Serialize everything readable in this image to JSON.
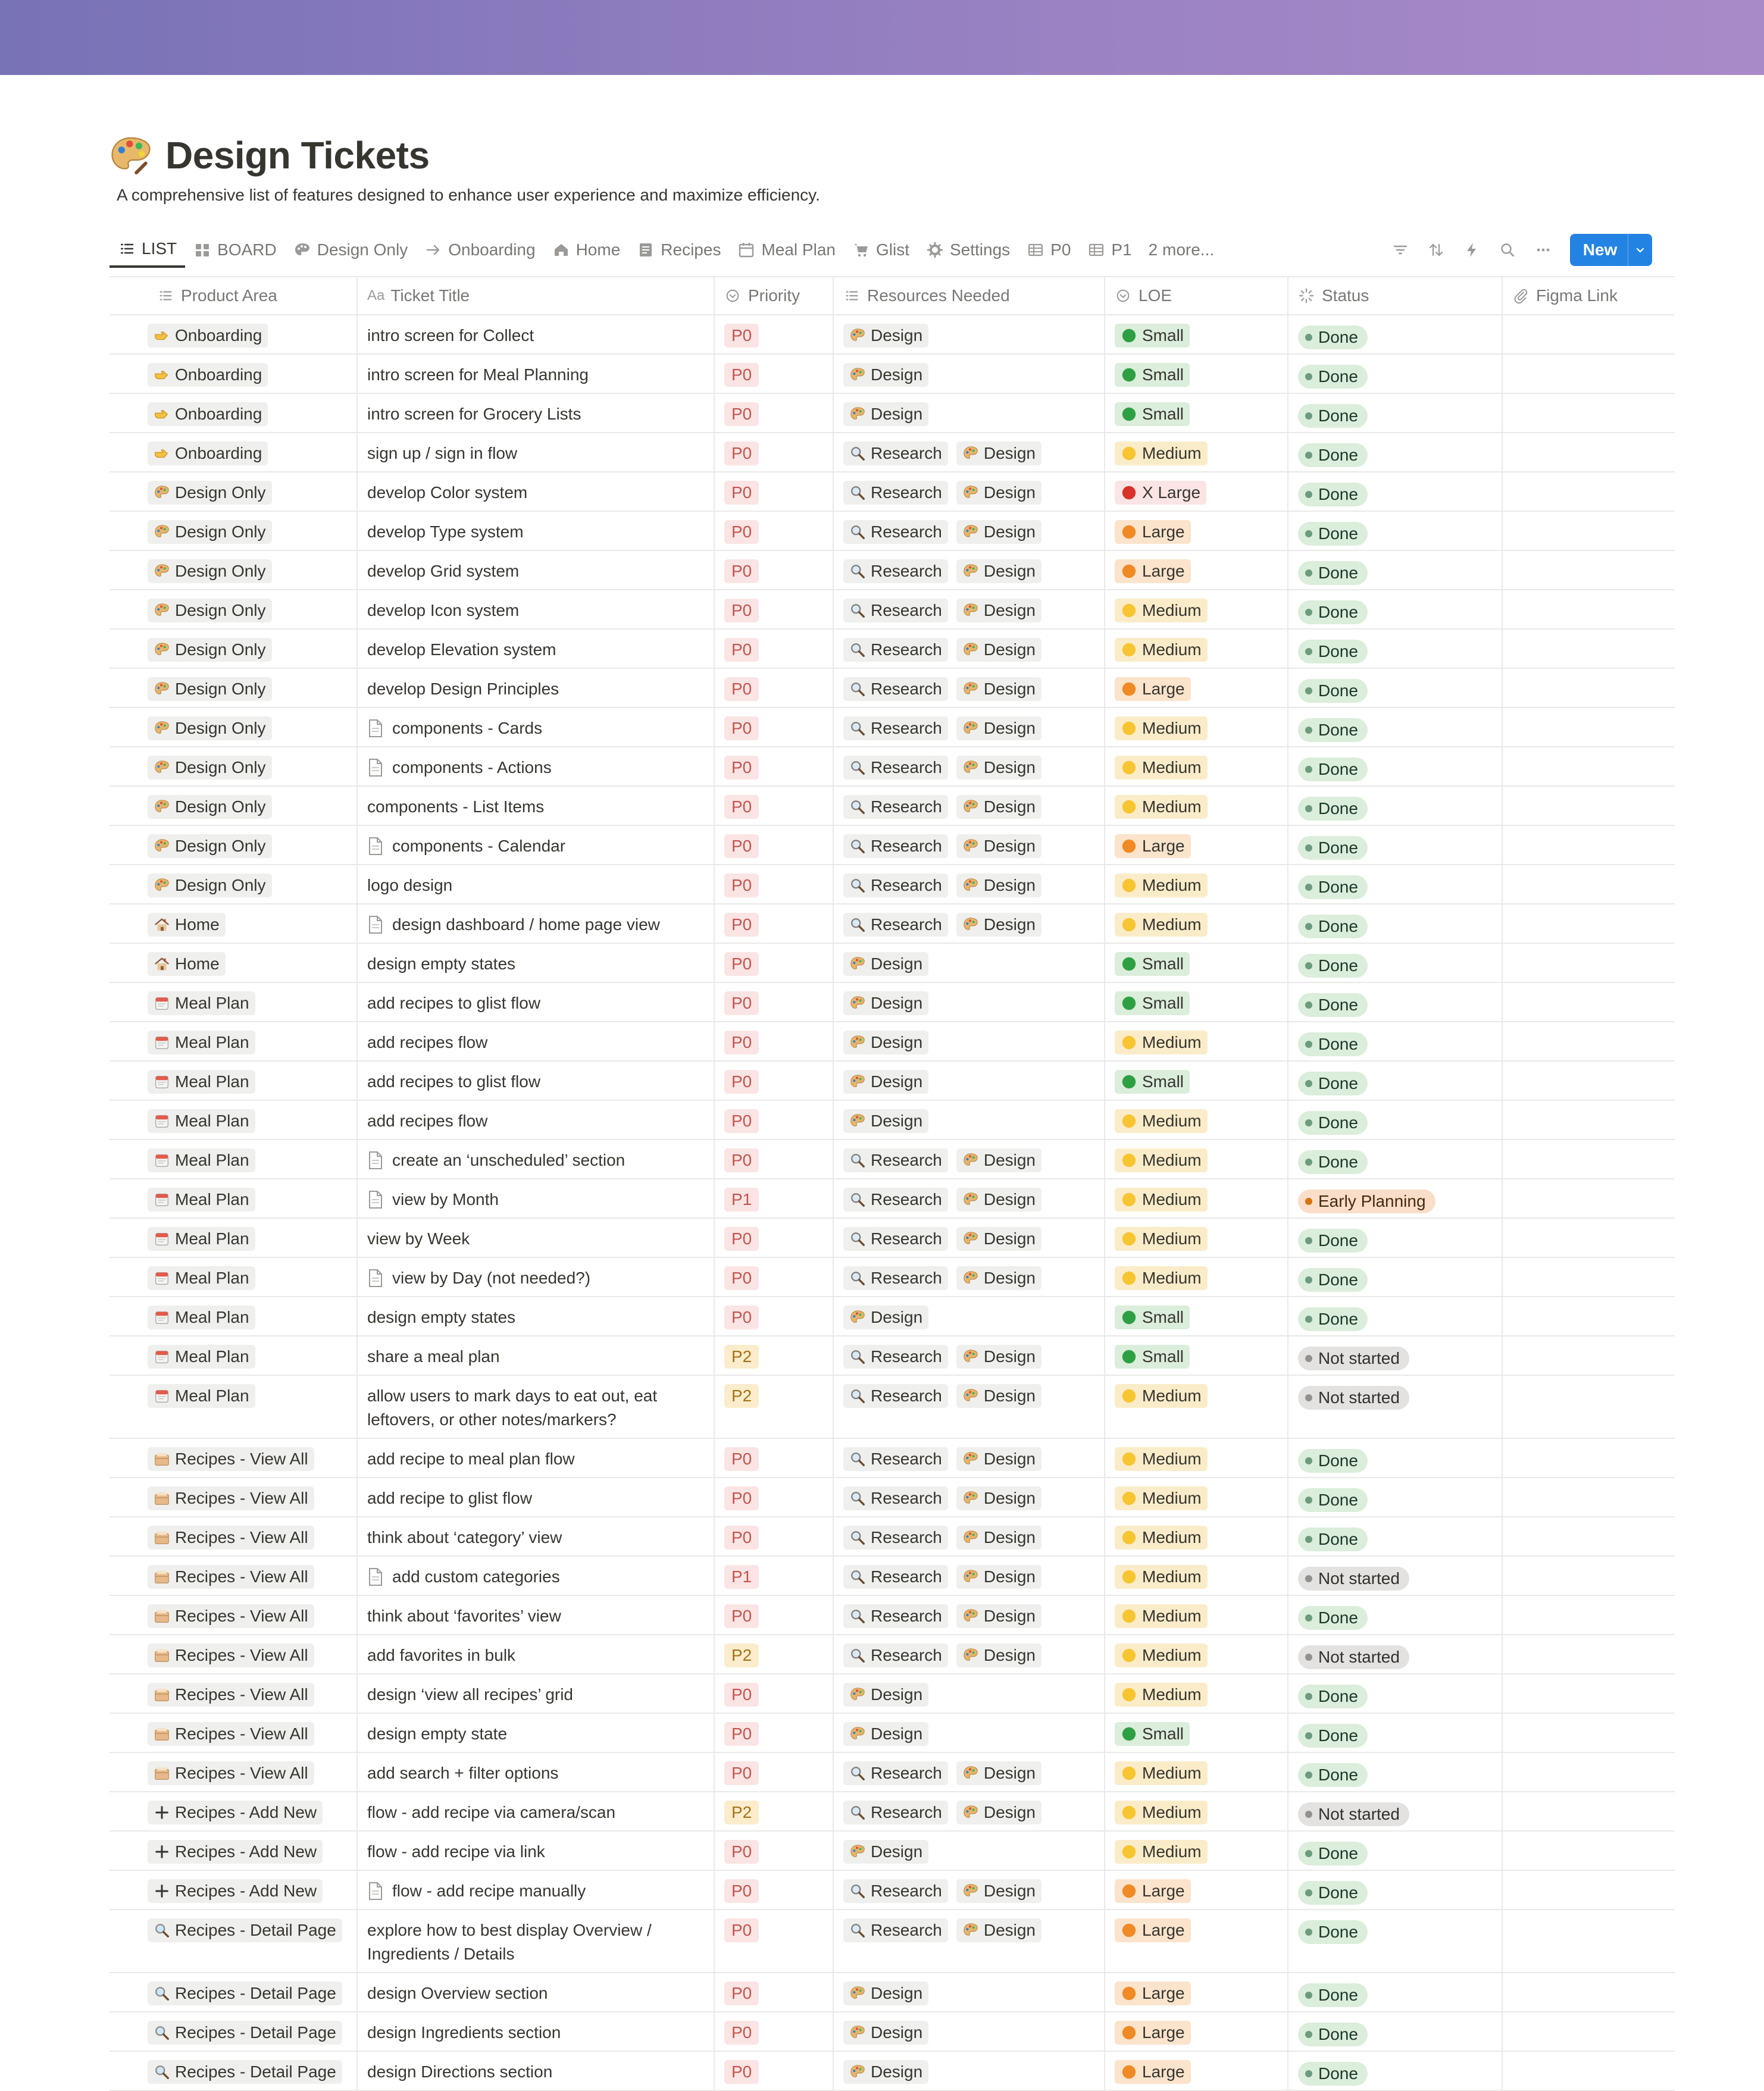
{
  "page": {
    "title": "Design Tickets",
    "title_icon": "palette-icon",
    "description": "A comprehensive list of features designed to enhance user experience and maximize efficiency.",
    "cover_colors": [
      "#7872b6",
      "#a98ac9"
    ]
  },
  "views": [
    {
      "label": "LIST",
      "icon": "list-icon",
      "active": true
    },
    {
      "label": "BOARD",
      "icon": "board-icon"
    },
    {
      "label": "Design Only",
      "icon": "palette-icon"
    },
    {
      "label": "Onboarding",
      "icon": "arrow-right-icon"
    },
    {
      "label": "Home",
      "icon": "home-icon"
    },
    {
      "label": "Recipes",
      "icon": "document-icon"
    },
    {
      "label": "Meal Plan",
      "icon": "calendar-icon"
    },
    {
      "label": "Glist",
      "icon": "cart-icon"
    },
    {
      "label": "Settings",
      "icon": "gear-icon"
    },
    {
      "label": "P0",
      "icon": "table-icon"
    },
    {
      "label": "P1",
      "icon": "table-icon"
    },
    {
      "label": "2 more...",
      "icon": ""
    }
  ],
  "toolbar": {
    "new_label": "New",
    "accent": "#2383e2"
  },
  "columns": [
    {
      "label": "Product Area",
      "icon": "list-icon"
    },
    {
      "label": "Ticket Title",
      "icon": "text-icon",
      "prefix": "Aa"
    },
    {
      "label": "Priority",
      "icon": "select-icon"
    },
    {
      "label": "Resources Needed",
      "icon": "list-icon"
    },
    {
      "label": "LOE",
      "icon": "select-icon"
    },
    {
      "label": "Status",
      "icon": "status-icon"
    },
    {
      "label": "Figma Link",
      "icon": "attachment-icon"
    }
  ],
  "rows": [
    {
      "area": "Onboarding",
      "title": "intro screen for Collect",
      "pri": "P0",
      "res": [
        "Design"
      ],
      "loe": "Small",
      "status": "Done"
    },
    {
      "area": "Onboarding",
      "title": "intro screen for Meal Planning",
      "pri": "P0",
      "res": [
        "Design"
      ],
      "loe": "Small",
      "status": "Done"
    },
    {
      "area": "Onboarding",
      "title": "intro screen for Grocery Lists",
      "pri": "P0",
      "res": [
        "Design"
      ],
      "loe": "Small",
      "status": "Done"
    },
    {
      "area": "Onboarding",
      "title": "sign up  / sign in flow",
      "pri": "P0",
      "res": [
        "Research",
        "Design"
      ],
      "loe": "Medium",
      "status": "Done"
    },
    {
      "area": "Design Only",
      "title": "develop Color system",
      "pri": "P0",
      "res": [
        "Research",
        "Design"
      ],
      "loe": "X Large",
      "status": "Done"
    },
    {
      "area": "Design Only",
      "title": "develop Type system",
      "pri": "P0",
      "res": [
        "Research",
        "Design"
      ],
      "loe": "Large",
      "status": "Done"
    },
    {
      "area": "Design Only",
      "title": "develop Grid system",
      "pri": "P0",
      "res": [
        "Research",
        "Design"
      ],
      "loe": "Large",
      "status": "Done"
    },
    {
      "area": "Design Only",
      "title": "develop Icon system",
      "pri": "P0",
      "res": [
        "Research",
        "Design"
      ],
      "loe": "Medium",
      "status": "Done"
    },
    {
      "area": "Design Only",
      "title": "develop Elevation system",
      "pri": "P0",
      "res": [
        "Research",
        "Design"
      ],
      "loe": "Medium",
      "status": "Done"
    },
    {
      "area": "Design Only",
      "title": "develop Design Principles",
      "pri": "P0",
      "res": [
        "Research",
        "Design"
      ],
      "loe": "Large",
      "status": "Done"
    },
    {
      "area": "Design Only",
      "title": "components - Cards",
      "doc": true,
      "pri": "P0",
      "res": [
        "Research",
        "Design"
      ],
      "loe": "Medium",
      "status": "Done"
    },
    {
      "area": "Design Only",
      "title": "components - Actions",
      "doc": true,
      "pri": "P0",
      "res": [
        "Research",
        "Design"
      ],
      "loe": "Medium",
      "status": "Done"
    },
    {
      "area": "Design Only",
      "title": "components - List Items",
      "pri": "P0",
      "res": [
        "Research",
        "Design"
      ],
      "loe": "Medium",
      "status": "Done"
    },
    {
      "area": "Design Only",
      "title": "components - Calendar",
      "doc": true,
      "pri": "P0",
      "res": [
        "Research",
        "Design"
      ],
      "loe": "Large",
      "status": "Done"
    },
    {
      "area": "Design Only",
      "title": "logo design",
      "pri": "P0",
      "res": [
        "Research",
        "Design"
      ],
      "loe": "Medium",
      "status": "Done"
    },
    {
      "area": "Home",
      "title": "design dashboard / home page view",
      "doc": true,
      "pri": "P0",
      "res": [
        "Research",
        "Design"
      ],
      "loe": "Medium",
      "status": "Done"
    },
    {
      "area": "Home",
      "title": "design empty states",
      "pri": "P0",
      "res": [
        "Design"
      ],
      "loe": "Small",
      "status": "Done"
    },
    {
      "area": "Meal Plan",
      "title": "add recipes to glist flow",
      "pri": "P0",
      "res": [
        "Design"
      ],
      "loe": "Small",
      "status": "Done"
    },
    {
      "area": "Meal Plan",
      "title": "add recipes flow",
      "pri": "P0",
      "res": [
        "Design"
      ],
      "loe": "Medium",
      "status": "Done"
    },
    {
      "area": "Meal Plan",
      "title": "add recipes to glist flow",
      "pri": "P0",
      "res": [
        "Design"
      ],
      "loe": "Small",
      "status": "Done"
    },
    {
      "area": "Meal Plan",
      "title": "add recipes flow",
      "pri": "P0",
      "res": [
        "Design"
      ],
      "loe": "Medium",
      "status": "Done"
    },
    {
      "area": "Meal Plan",
      "title": "create an ‘unscheduled’ section",
      "doc": true,
      "pri": "P0",
      "res": [
        "Research",
        "Design"
      ],
      "loe": "Medium",
      "status": "Done"
    },
    {
      "area": "Meal Plan",
      "title": "view by Month",
      "doc": true,
      "pri": "P1",
      "res": [
        "Research",
        "Design"
      ],
      "loe": "Medium",
      "status": "Early Planning"
    },
    {
      "area": "Meal Plan",
      "title": "view by Week",
      "pri": "P0",
      "res": [
        "Research",
        "Design"
      ],
      "loe": "Medium",
      "status": "Done"
    },
    {
      "area": "Meal Plan",
      "title": "view by Day (not needed?)",
      "doc": true,
      "pri": "P0",
      "res": [
        "Research",
        "Design"
      ],
      "loe": "Medium",
      "status": "Done"
    },
    {
      "area": "Meal Plan",
      "title": "design empty states",
      "pri": "P0",
      "res": [
        "Design"
      ],
      "loe": "Small",
      "status": "Done"
    },
    {
      "area": "Meal Plan",
      "title": "share a meal plan",
      "pri": "P2",
      "res": [
        "Research",
        "Design"
      ],
      "loe": "Small",
      "status": "Not started"
    },
    {
      "area": "Meal Plan",
      "title": "allow users to mark days to eat out, eat leftovers, or other notes/markers?",
      "tall": true,
      "pri": "P2",
      "res": [
        "Research",
        "Design"
      ],
      "loe": "Medium",
      "status": "Not started"
    },
    {
      "area": "Recipes - View All",
      "title": "add recipe to meal plan flow",
      "pri": "P0",
      "res": [
        "Research",
        "Design"
      ],
      "loe": "Medium",
      "status": "Done"
    },
    {
      "area": "Recipes - View All",
      "title": "add recipe to glist flow",
      "pri": "P0",
      "res": [
        "Research",
        "Design"
      ],
      "loe": "Medium",
      "status": "Done"
    },
    {
      "area": "Recipes - View All",
      "title": "think about ‘category’ view",
      "pri": "P0",
      "res": [
        "Research",
        "Design"
      ],
      "loe": "Medium",
      "status": "Done"
    },
    {
      "area": "Recipes - View All",
      "title": "add custom categories",
      "doc": true,
      "pri": "P1",
      "res": [
        "Research",
        "Design"
      ],
      "loe": "Medium",
      "status": "Not started"
    },
    {
      "area": "Recipes - View All",
      "title": "think about ‘favorites’ view",
      "pri": "P0",
      "res": [
        "Research",
        "Design"
      ],
      "loe": "Medium",
      "status": "Done"
    },
    {
      "area": "Recipes - View All",
      "title": "add favorites in bulk",
      "pri": "P2",
      "res": [
        "Research",
        "Design"
      ],
      "loe": "Medium",
      "status": "Not started"
    },
    {
      "area": "Recipes - View All",
      "title": "design ‘view all recipes’ grid",
      "pri": "P0",
      "res": [
        "Design"
      ],
      "loe": "Medium",
      "status": "Done"
    },
    {
      "area": "Recipes - View All",
      "title": "design empty state",
      "pri": "P0",
      "res": [
        "Design"
      ],
      "loe": "Small",
      "status": "Done"
    },
    {
      "area": "Recipes - View All",
      "title": "add search + filter options",
      "pri": "P0",
      "res": [
        "Research",
        "Design"
      ],
      "loe": "Medium",
      "status": "Done"
    },
    {
      "area": "Recipes - Add New",
      "title": "flow - add recipe via camera/scan",
      "pri": "P2",
      "res": [
        "Research",
        "Design"
      ],
      "loe": "Medium",
      "status": "Not started"
    },
    {
      "area": "Recipes - Add New",
      "title": "flow - add recipe via link",
      "pri": "P0",
      "res": [
        "Design"
      ],
      "loe": "Medium",
      "status": "Done"
    },
    {
      "area": "Recipes - Add New",
      "title": "flow - add recipe manually",
      "doc": true,
      "pri": "P0",
      "res": [
        "Research",
        "Design"
      ],
      "loe": "Large",
      "status": "Done"
    },
    {
      "area": "Recipes - Detail Page",
      "title": "explore how to best display Overview / Ingredients / Details",
      "tall": true,
      "pri": "P0",
      "res": [
        "Research",
        "Design"
      ],
      "loe": "Large",
      "status": "Done"
    },
    {
      "area": "Recipes - Detail Page",
      "title": "design Overview section",
      "pri": "P0",
      "res": [
        "Design"
      ],
      "loe": "Large",
      "status": "Done"
    },
    {
      "area": "Recipes - Detail Page",
      "title": "design Ingredients section",
      "pri": "P0",
      "res": [
        "Design"
      ],
      "loe": "Large",
      "status": "Done"
    },
    {
      "area": "Recipes - Detail Page",
      "title": "design Directions section",
      "pri": "P0",
      "res": [
        "Design"
      ],
      "loe": "Large",
      "status": "Done"
    }
  ]
}
